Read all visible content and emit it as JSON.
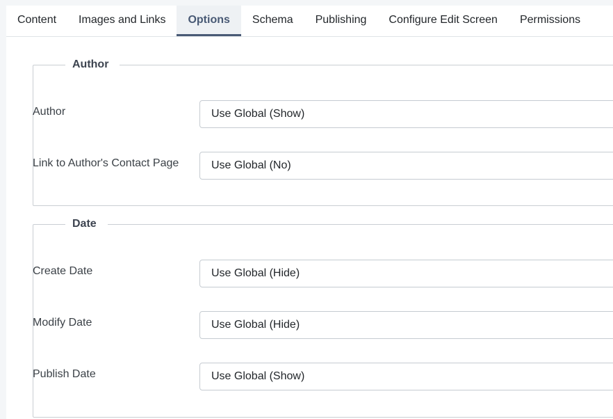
{
  "tabs": [
    {
      "label": "Content"
    },
    {
      "label": "Images and Links"
    },
    {
      "label": "Options",
      "active": true
    },
    {
      "label": "Schema"
    },
    {
      "label": "Publishing"
    },
    {
      "label": "Configure Edit Screen"
    },
    {
      "label": "Permissions"
    }
  ],
  "author_group": {
    "legend": "Author",
    "fields": [
      {
        "label": "Author",
        "value": "Use Global (Show)"
      },
      {
        "label": "Link to Author's Contact Page",
        "value": "Use Global (No)"
      }
    ]
  },
  "date_group": {
    "legend": "Date",
    "fields": [
      {
        "label": "Create Date",
        "value": "Use Global (Hide)"
      },
      {
        "label": "Modify Date",
        "value": "Use Global (Hide)"
      },
      {
        "label": "Publish Date",
        "value": "Use Global (Show)"
      }
    ]
  },
  "colors": {
    "active_tab": "#495a75",
    "border": "#c9ced3"
  }
}
